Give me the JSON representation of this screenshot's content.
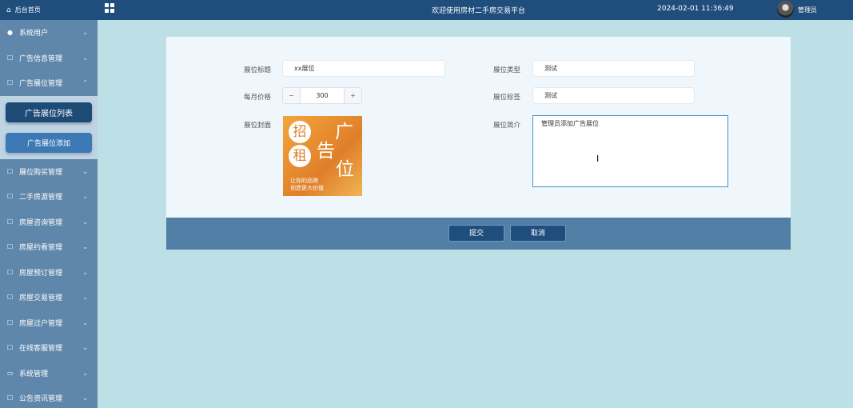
{
  "sidebar": {
    "home": "后台首页",
    "items": [
      {
        "label": "系统用户",
        "icon": "user-icon",
        "chevron": "chevron-down-icon"
      },
      {
        "label": "广告信息管理",
        "icon": "external-icon",
        "chevron": "chevron-down-icon"
      },
      {
        "label": "广告展位管理",
        "icon": "external-icon",
        "chevron": "chevron-up-icon"
      }
    ],
    "sub": {
      "active": "广告展位列表",
      "normal": "广告展位添加"
    },
    "items2": [
      {
        "label": "展位购买管理"
      },
      {
        "label": "二手房源管理"
      },
      {
        "label": "房屋咨询管理"
      },
      {
        "label": "房屋约看管理"
      },
      {
        "label": "房屋预订管理"
      },
      {
        "label": "房屋交易管理"
      },
      {
        "label": "房屋过户管理"
      },
      {
        "label": "在线客服管理"
      },
      {
        "label": "系统管理"
      },
      {
        "label": "公告资讯管理"
      }
    ]
  },
  "topbar": {
    "title": "欢迎使用房材二手房交易平台",
    "time": "2024-02-01 11:36:49",
    "user": "管理员"
  },
  "form": {
    "title_label": "展位标题",
    "title_value": "xx展位",
    "type_label": "展位类型",
    "type_value": "测试",
    "price_label": "每月价格",
    "price_value": "300",
    "price_minus": "−",
    "price_plus": "+",
    "tag_label": "展位标签",
    "tag_value": "测试",
    "cover_label": "展位封面",
    "intro_label": "展位简介",
    "intro_value": "管理员添加广告展位",
    "cover": {
      "c1": "招",
      "c2": "租",
      "b1": "广",
      "b2": "告",
      "b3": "位",
      "line1": "让你的品牌",
      "line2": "创造更大价值"
    }
  },
  "buttons": {
    "submit": "提交",
    "cancel": "取消"
  }
}
